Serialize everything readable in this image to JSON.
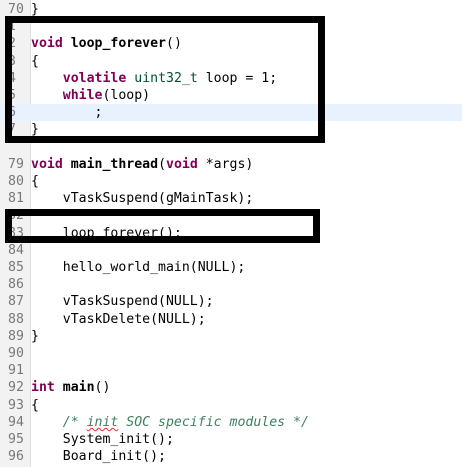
{
  "lines": [
    {
      "n": "70",
      "code": "}"
    },
    {
      "n": "1",
      "code": ""
    },
    {
      "n": "2",
      "code_parts": [
        {
          "t": "void",
          "c": "kw"
        },
        {
          "t": " "
        },
        {
          "t": "loop_forever",
          "c": "fn"
        },
        {
          "t": "()"
        }
      ]
    },
    {
      "n": "3",
      "code": "{"
    },
    {
      "n": "4",
      "code_parts": [
        {
          "t": "    "
        },
        {
          "t": "volatile",
          "c": "kw"
        },
        {
          "t": " "
        },
        {
          "t": "uint32_t",
          "c": "type"
        },
        {
          "t": " loop = 1;"
        }
      ]
    },
    {
      "n": "5",
      "code_parts": [
        {
          "t": "    "
        },
        {
          "t": "while",
          "c": "kw"
        },
        {
          "t": "(loop)"
        }
      ]
    },
    {
      "n": "6",
      "code": "        ;"
    },
    {
      "n": "7",
      "code": "}"
    },
    {
      "n": "",
      "code": ""
    },
    {
      "n": "79",
      "code_parts": [
        {
          "t": "void",
          "c": "kw"
        },
        {
          "t": " "
        },
        {
          "t": "main_thread",
          "c": "fn"
        },
        {
          "t": "("
        },
        {
          "t": "void",
          "c": "kw"
        },
        {
          "t": " *args)"
        }
      ]
    },
    {
      "n": "80",
      "code": "{"
    },
    {
      "n": "81",
      "code": "    vTaskSuspend(gMainTask);"
    },
    {
      "n": "82",
      "code": ""
    },
    {
      "n": "83",
      "code": "    loop_forever();"
    },
    {
      "n": "84",
      "code": ""
    },
    {
      "n": "85",
      "code": "    hello_world_main(NULL);"
    },
    {
      "n": "86",
      "code": ""
    },
    {
      "n": "87",
      "code": "    vTaskSuspend(NULL);"
    },
    {
      "n": "88",
      "code": "    vTaskDelete(NULL);"
    },
    {
      "n": "89",
      "code": "}"
    },
    {
      "n": "90",
      "code": ""
    },
    {
      "n": "91",
      "code": ""
    },
    {
      "n": "92",
      "code_parts": [
        {
          "t": "int",
          "c": "kw"
        },
        {
          "t": " "
        },
        {
          "t": "main",
          "c": "fn"
        },
        {
          "t": "()"
        }
      ]
    },
    {
      "n": "93",
      "code": "{"
    },
    {
      "n": "94",
      "code_parts": [
        {
          "t": "    "
        },
        {
          "t": "/* ",
          "c": "cm"
        },
        {
          "t": "init",
          "c": "cm squig"
        },
        {
          "t": " SOC specific modules */",
          "c": "cm"
        }
      ]
    },
    {
      "n": "95",
      "code": "    System_init();"
    },
    {
      "n": "96",
      "code": "    Board_init();"
    }
  ],
  "current_line_index": 6
}
